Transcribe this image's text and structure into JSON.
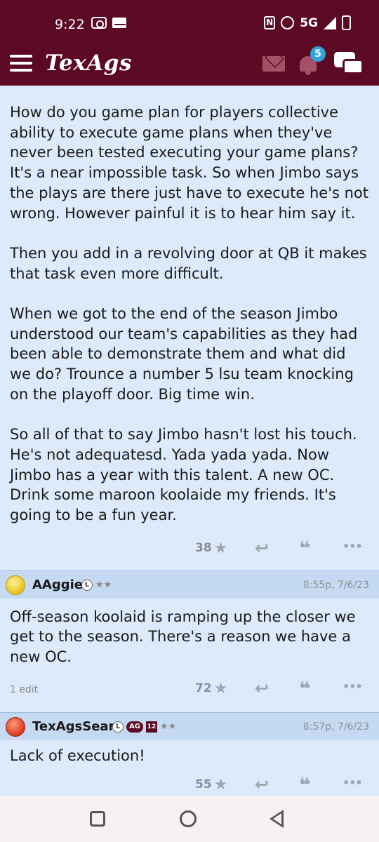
{
  "status_bar": {
    "time": "9:22",
    "network": "5G"
  },
  "header": {
    "logo": "TexAgs",
    "notification_count": "5"
  },
  "posts": [
    {
      "paragraphs": [
        "How do you game plan for players collective ability to execute game plans when they've never been tested executing your game plans? It's a near impossible task. So when Jimbo says the plays are there just have to execute he's not wrong. However painful it is to hear him say it.",
        "Then you add in a revolving door at QB it makes that task even more difficult.",
        "When we got to the end of the season Jimbo understood our team's capabilities as they had been able to demonstrate them and what did we do? Trounce a number 5 lsu team knocking on the playoff door. Big time win.",
        "So all of that to say Jimbo hasn't lost his touch. He's not adequatesd. Yada yada yada. Now Jimbo has a year with this talent. A new OC. Drink some maroon koolaide my friends. It's going to be a fun year."
      ],
      "stars": "38"
    },
    {
      "username": "AAggie",
      "badge_l": "L",
      "rank_stars": "★★",
      "timestamp": "8:55p, 7/6/23",
      "text": "Off-season koolaid is ramping up the closer we get to the season. There's a reason we have a new OC.",
      "edit_note": "1 edit",
      "stars": "72"
    },
    {
      "username": "TexAgsSean",
      "badge_l": "L",
      "badge_ag": "AG",
      "badge_12": "12",
      "rank_stars": "★★",
      "timestamp": "8:57p, 7/6/23",
      "text": "Lack of execution!",
      "stars": "55"
    }
  ],
  "icons": {
    "star": "★",
    "reply": "↩",
    "quote": "❝",
    "more": "•••"
  }
}
